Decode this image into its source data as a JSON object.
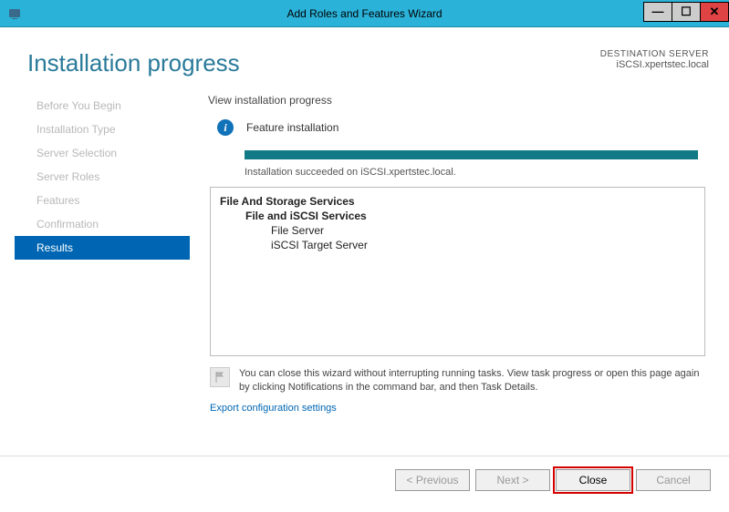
{
  "titlebar": {
    "title": "Add Roles and Features Wizard"
  },
  "header": {
    "page_title": "Installation progress",
    "dest_label": "DESTINATION SERVER",
    "dest_server": "iSCSI.xpertstec.local"
  },
  "sidebar": {
    "items": [
      {
        "label": "Before You Begin",
        "active": false
      },
      {
        "label": "Installation Type",
        "active": false
      },
      {
        "label": "Server Selection",
        "active": false
      },
      {
        "label": "Server Roles",
        "active": false
      },
      {
        "label": "Features",
        "active": false
      },
      {
        "label": "Confirmation",
        "active": false
      },
      {
        "label": "Results",
        "active": true
      }
    ]
  },
  "panel": {
    "heading": "View installation progress",
    "feature_label": "Feature installation",
    "success_text": "Installation succeeded on iSCSI.xpertstec.local.",
    "tree": {
      "l0": "File And Storage Services",
      "l1": "File and iSCSI Services",
      "l2a": "File Server",
      "l2b": "iSCSI Target Server"
    },
    "note_text": "You can close this wizard without interrupting running tasks. View task progress or open this page again by clicking Notifications in the command bar, and then Task Details.",
    "export_link": "Export configuration settings"
  },
  "footer": {
    "previous": "<  Previous",
    "next": "Next  >",
    "close": "Close",
    "cancel": "Cancel"
  }
}
